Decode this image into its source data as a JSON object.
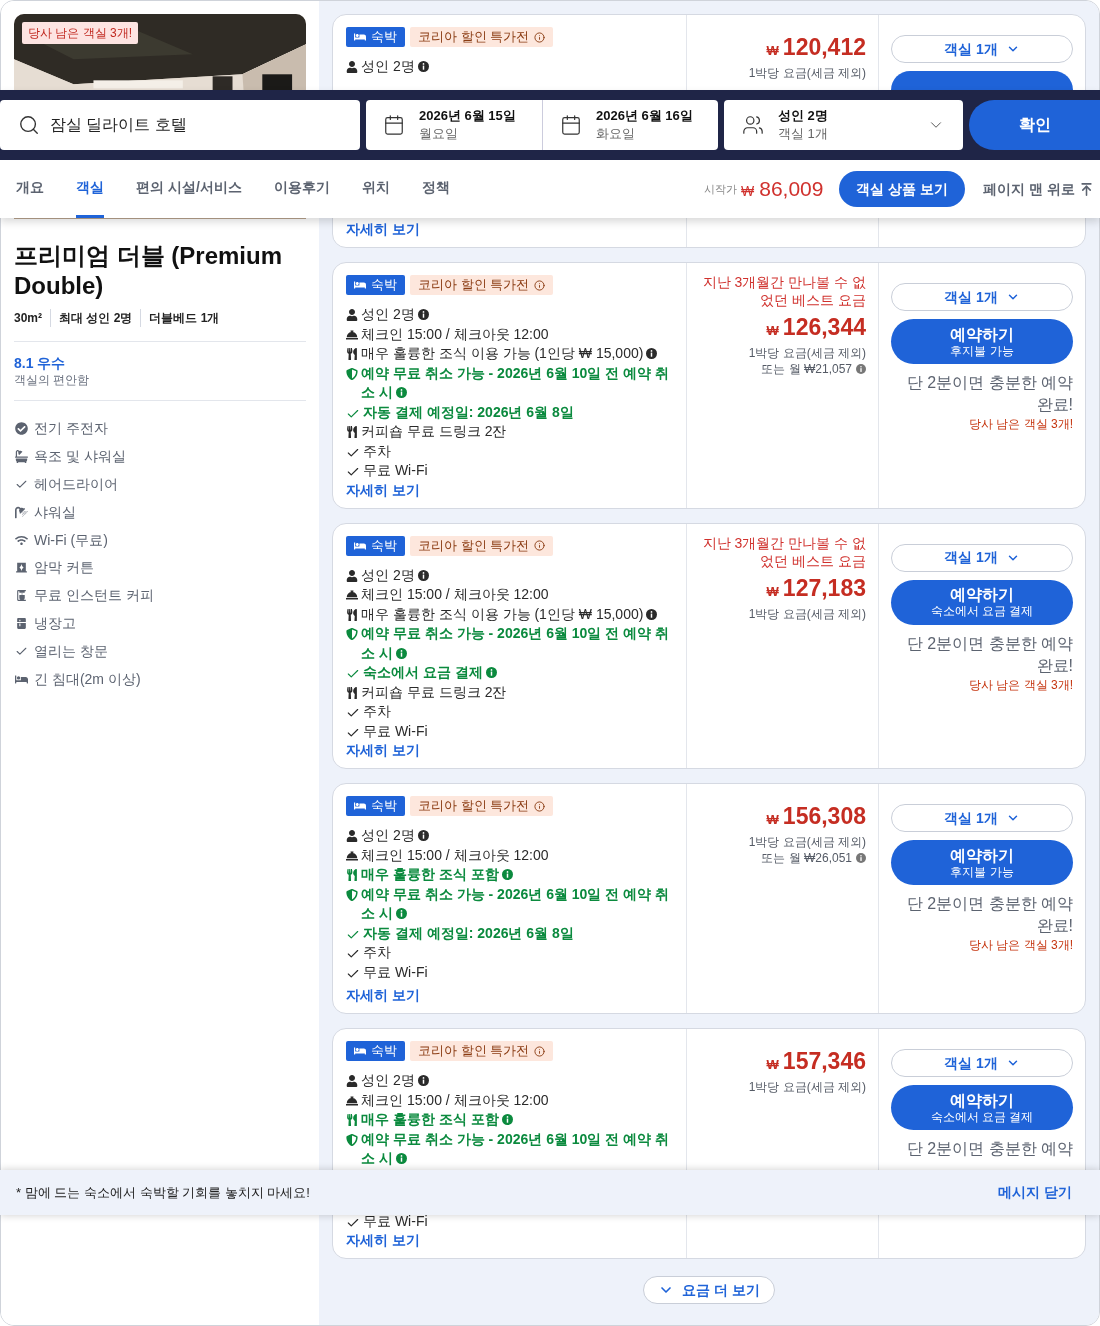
{
  "room": {
    "photo": {
      "kind": "picture",
      "badge": "당사 남은 객실 3개!"
    },
    "title": "프리미엄 더블 (Premium Double)",
    "specs": [
      "30m²",
      "최대 성인 2명",
      "더블베드 1개"
    ],
    "rating": {
      "score": "8.1 우수",
      "label": "객실의 편안함"
    },
    "amenities": [
      {
        "kind": "check-circle",
        "text": "전기 주전자"
      },
      {
        "kind": "bath",
        "text": "욕조 및 샤워실"
      },
      {
        "kind": "check",
        "text": "헤어드라이어"
      },
      {
        "kind": "shower",
        "text": "샤워실"
      },
      {
        "kind": "wifi",
        "text": "Wi-Fi (무료)"
      },
      {
        "kind": "curtain",
        "text": "암막 커튼"
      },
      {
        "kind": "coffee",
        "text": "무료 인스턴트 커피"
      },
      {
        "kind": "fridge",
        "text": "냉장고"
      },
      {
        "kind": "check",
        "text": "열리는 창문"
      },
      {
        "kind": "bed",
        "text": "긴 침대(2m 이상)"
      }
    ]
  },
  "offers": [
    {
      "type": "숙박",
      "promo": "코리아 할인 특가전",
      "rows": [
        {
          "kind": "person",
          "text": "성인 2명",
          "info": true,
          "highlight": false
        }
      ],
      "details": "자세히 보기",
      "currency": "₩",
      "price": "120,412",
      "per_night": "1박당 요금(세금 제외)",
      "rooms": "객실 1개"
    },
    {
      "type": "숙박",
      "promo": "코리아 할인 특가전",
      "rows": [
        {
          "kind": "person",
          "text": "성인 2명",
          "info": true,
          "highlight": false
        },
        {
          "kind": "concierge",
          "text": "체크인 15:00 / 체크아웃 12:00",
          "info": false,
          "highlight": false
        },
        {
          "kind": "dining",
          "text": "매우 훌륭한 조식 이용 가능 (1인당 ₩ 15,000)",
          "info": true,
          "highlight": false
        },
        {
          "kind": "shield",
          "text": "예약 무료 취소 가능 - 2026년 6월 10일 전 예약 취소 시",
          "info": true,
          "highlight": true
        },
        {
          "kind": "check",
          "text": "자동 결제 예정일: 2026년 6월 8일",
          "info": false,
          "highlight": true
        },
        {
          "kind": "dining",
          "text": "커피숍 무료 드링크 2잔",
          "info": false,
          "highlight": false
        },
        {
          "kind": "check",
          "text": "주차",
          "info": false,
          "highlight": false
        },
        {
          "kind": "check",
          "text": "무료 Wi-Fi",
          "info": false,
          "highlight": false
        }
      ],
      "details": "자세히 보기",
      "notice": "지난 3개월간 만나볼 수 없었던 베스트 요금",
      "currency": "₩",
      "price": "126,344",
      "per_night": "1박당 요금(세금 제외)",
      "monthly": "또는 월 ₩21,057",
      "rooms": "객실 1개",
      "book": {
        "label": "예약하기",
        "sub": "후지불 가능"
      },
      "pitch": "단 2분이면 충분한 예약 완료!",
      "scarcity": "당사 남은 객실 3개!"
    },
    {
      "type": "숙박",
      "promo": "코리아 할인 특가전",
      "rows": [
        {
          "kind": "person",
          "text": "성인 2명",
          "info": true,
          "highlight": false
        },
        {
          "kind": "concierge",
          "text": "체크인 15:00 / 체크아웃 12:00",
          "info": false,
          "highlight": false
        },
        {
          "kind": "dining",
          "text": "매우 훌륭한 조식 이용 가능 (1인당 ₩ 15,000)",
          "info": true,
          "highlight": false
        },
        {
          "kind": "shield",
          "text": "예약 무료 취소 가능 - 2026년 6월 10일 전 예약 취소 시",
          "info": true,
          "highlight": true
        },
        {
          "kind": "check",
          "text": "숙소에서 요금 결제",
          "info": true,
          "highlight": true
        },
        {
          "kind": "dining",
          "text": "커피숍 무료 드링크 2잔",
          "info": false,
          "highlight": false
        },
        {
          "kind": "check",
          "text": "주차",
          "info": false,
          "highlight": false
        },
        {
          "kind": "check",
          "text": "무료 Wi-Fi",
          "info": false,
          "highlight": false
        }
      ],
      "details": "자세히 보기",
      "notice": "지난 3개월간 만나볼 수 없었던 베스트 요금",
      "currency": "₩",
      "price": "127,183",
      "per_night": "1박당 요금(세금 제외)",
      "rooms": "객실 1개",
      "book": {
        "label": "예약하기",
        "sub": "숙소에서 요금 결제"
      },
      "pitch": "단 2분이면 충분한 예약 완료!",
      "scarcity": "당사 남은 객실 3개!"
    },
    {
      "type": "숙박",
      "promo": "코리아 할인 특가전",
      "rows": [
        {
          "kind": "person",
          "text": "성인 2명",
          "info": true,
          "highlight": false
        },
        {
          "kind": "concierge",
          "text": "체크인 15:00 / 체크아웃 12:00",
          "info": false,
          "highlight": false
        },
        {
          "kind": "dining",
          "text": "매우 훌륭한 조식 포함",
          "info": true,
          "highlight": true
        },
        {
          "kind": "shield",
          "text": "예약 무료 취소 가능 - 2026년 6월 10일 전 예약 취소 시",
          "info": true,
          "highlight": true
        },
        {
          "kind": "check",
          "text": "자동 결제 예정일: 2026년 6월 8일",
          "info": false,
          "highlight": true
        },
        {
          "kind": "check",
          "text": "주차",
          "info": false,
          "highlight": false
        },
        {
          "kind": "check",
          "text": "무료 Wi-Fi",
          "info": false,
          "highlight": false
        }
      ],
      "details": "자세히 보기",
      "currency": "₩",
      "price": "156,308",
      "per_night": "1박당 요금(세금 제외)",
      "monthly": "또는 월 ₩26,051",
      "rooms": "객실 1개",
      "book": {
        "label": "예약하기",
        "sub": "후지불 가능"
      },
      "pitch": "단 2분이면 충분한 예약 완료!",
      "scarcity": "당사 남은 객실 3개!"
    },
    {
      "type": "숙박",
      "promo": "코리아 할인 특가전",
      "rows": [
        {
          "kind": "person",
          "text": "성인 2명",
          "info": true,
          "highlight": false
        },
        {
          "kind": "concierge",
          "text": "체크인 15:00 / 체크아웃 12:00",
          "info": false,
          "highlight": false
        },
        {
          "kind": "dining",
          "text": "매우 훌륭한 조식 포함",
          "info": true,
          "highlight": true
        },
        {
          "kind": "shield",
          "text": "예약 무료 취소 가능 - 2026년 6월 10일 전 예약 취소 시",
          "info": true,
          "highlight": true
        }
      ],
      "bottom_rows": [
        {
          "kind": "check",
          "text": "무료 Wi-Fi",
          "info": false,
          "highlight": false
        }
      ],
      "details": "자세히 보기",
      "currency": "₩",
      "price": "157,346",
      "per_night": "1박당 요금(세금 제외)",
      "rooms": "객실 1개",
      "book": {
        "label": "예약하기",
        "sub": "숙소에서 요금 결제"
      },
      "pitch": "단 2분이면 충분한 예약"
    }
  ],
  "more_rates": "요금 더 보기",
  "search_bar": {
    "destination": "잠실 딜라이트 호텔",
    "checkin": {
      "date": "2026년 6월 15일",
      "weekday": "월요일"
    },
    "checkout": {
      "date": "2026년 6월 16일",
      "weekday": "화요일"
    },
    "guests": {
      "adults": "성인 2명",
      "rooms": "객실 1개"
    },
    "submit": "확인"
  },
  "nav": {
    "tabs": [
      {
        "label": "개요",
        "selected": false
      },
      {
        "label": "객실",
        "selected": true
      },
      {
        "label": "편의 시설/서비스",
        "selected": false
      },
      {
        "label": "이용후기",
        "selected": false
      },
      {
        "label": "위치",
        "selected": false
      },
      {
        "label": "정책",
        "selected": false
      }
    ],
    "from_label": "시작가",
    "currency": "₩",
    "from_price": "86,009",
    "cta": "객실 상품 보기",
    "to_top": "페이지 맨 위로"
  },
  "banner": {
    "message": "* 맘에 드는 숙소에서 숙박할 기회를 놓치지 마세요!",
    "close": "메시지 닫기"
  }
}
